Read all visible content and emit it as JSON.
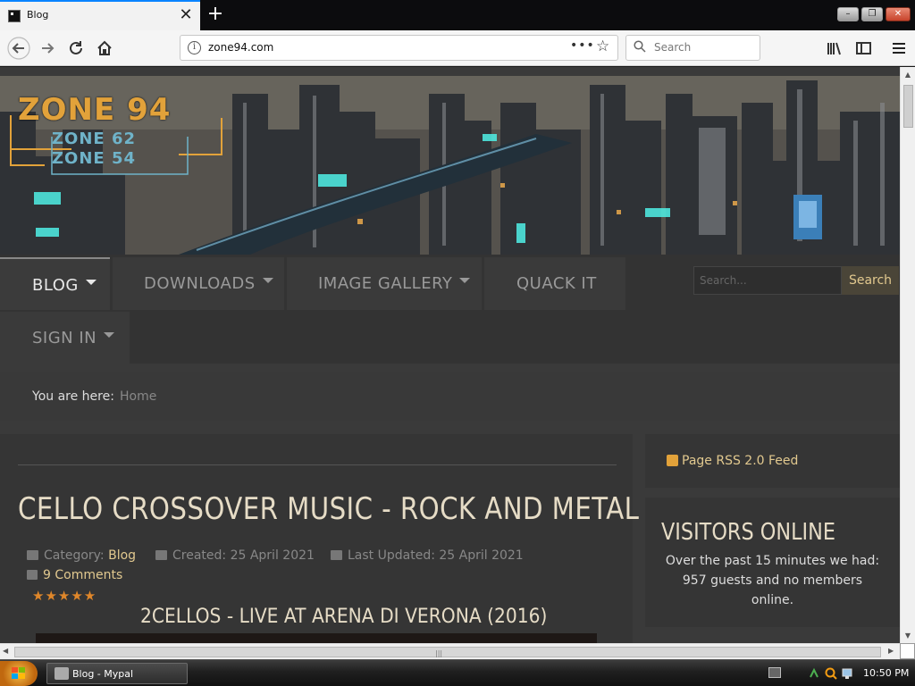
{
  "browser": {
    "tab_title": "Blog",
    "url": "zone94.com",
    "search_placeholder": "Search",
    "window_buttons": {
      "minimize": "–",
      "restore": "❐",
      "close": "✕"
    }
  },
  "site": {
    "logo": {
      "line1": "ZONE 94",
      "line2": "ZONE 62",
      "line3": "ZONE 54"
    },
    "menu": [
      {
        "label": "BLOG",
        "has_dropdown": true,
        "active": true
      },
      {
        "label": "DOWNLOADS",
        "has_dropdown": true
      },
      {
        "label": "IMAGE GALLERY",
        "has_dropdown": true
      },
      {
        "label": "QUACK IT",
        "has_dropdown": false
      },
      {
        "label": "SIGN IN",
        "has_dropdown": true
      }
    ],
    "search": {
      "placeholder": "Search...",
      "button": "Search"
    },
    "breadcrumb": {
      "label": "You are here:",
      "home": "Home"
    },
    "article": {
      "title": "CELLO CROSSOVER MUSIC - ROCK AND METAL",
      "category_label": "Category:",
      "category": "Blog",
      "created": "Created: 25 April 2021",
      "updated": "Last Updated: 25 April 2021",
      "comments": "9 Comments",
      "stars": "★★★★★",
      "rating": 5,
      "video_title": "2CELLOS - LIVE AT ARENA DI VERONA (2016)"
    },
    "sidebar": {
      "rss": "Page RSS 2.0 Feed",
      "visitors_title": "VISITORS ONLINE",
      "visitors_text": "Over the past 15 minutes we had: 957 guests and no members online."
    }
  },
  "colors": {
    "accent": "#e2c98f",
    "page_bg": "#3a3a3a",
    "star": "#e0872a"
  },
  "taskbar": {
    "window": "Blog - Mypal",
    "clock": "10:50 PM"
  }
}
